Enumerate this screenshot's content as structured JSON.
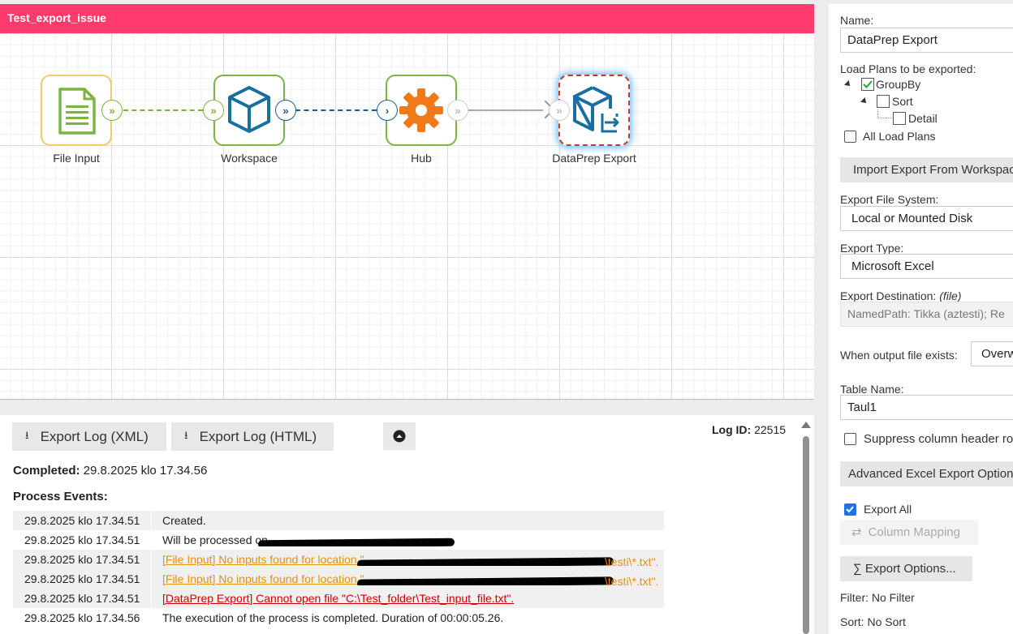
{
  "canvas": {
    "title": "Test_export_issue",
    "nodes": [
      {
        "label": "File Input",
        "icon": "document-icon",
        "border": "#f3c96b"
      },
      {
        "label": "Workspace",
        "icon": "cube-icon",
        "border": "#7cb342"
      },
      {
        "label": "Hub",
        "icon": "gear-icon",
        "border": "#7cb342"
      },
      {
        "label": "DataPrep Export",
        "icon": "cube-export-icon",
        "border": "#c0392b"
      }
    ],
    "colors": {
      "title_bar": "#ff3a6c",
      "green_port": "#7cb342",
      "blue_port": "#1a5e8c",
      "gear": "#f07a1a",
      "cube": "#1a6ea0"
    }
  },
  "log": {
    "export_xml_label": "Export Log (XML)",
    "export_html_label": "Export Log (HTML)",
    "log_id_label": "Log ID:",
    "log_id_value": "22515",
    "completed_label": "Completed:",
    "completed_value": "29.8.2025 klo 17.34.56",
    "events_heading": "Process Events:",
    "events": [
      {
        "time": "29.8.2025 klo 17.34.51",
        "text": "Created.",
        "level": "info"
      },
      {
        "time": "29.8.2025 klo 17.34.51",
        "text": "Will be processed on",
        "level": "info"
      },
      {
        "time": "29.8.2025 klo 17.34.51",
        "text": "[File Input] No inputs found for location \"",
        "suffix": "\\testi\\*.txt\".",
        "level": "warn"
      },
      {
        "time": "29.8.2025 klo 17.34.51",
        "text": "[File Input] No inputs found for location \"",
        "suffix": "\\testi\\*.txt\".",
        "level": "warn"
      },
      {
        "time": "29.8.2025 klo 17.34.51",
        "text": "[DataPrep Export] Cannot open file \"C:\\Test_folder\\Test_input_file.txt\".",
        "level": "err"
      },
      {
        "time": "29.8.2025 klo 17.34.56",
        "text": "The execution of the process is completed. Duration of 00:00:05.26.",
        "level": "info"
      }
    ]
  },
  "panel": {
    "name_label": "Name:",
    "name_value": "DataPrep Export",
    "load_plans_label": "Load Plans to be exported:",
    "tree": [
      {
        "label": "GroupBy",
        "checked": true
      },
      {
        "label": "Sort",
        "checked": false
      },
      {
        "label": "Detail",
        "checked": false
      }
    ],
    "all_load_plans_label": "All Load Plans",
    "import_button": "Import Export From Workspace",
    "file_system_label": "Export File System:",
    "file_system_value": "Local or Mounted Disk",
    "export_type_label": "Export Type:",
    "export_type_value": "Microsoft Excel",
    "destination_label": "Export Destination:",
    "destination_hint": "(file)",
    "destination_value": "NamedPath: Tikka (aztesti); Re",
    "when_exists_label": "When output file exists:",
    "when_exists_value": "Overw",
    "table_name_label": "Table Name:",
    "table_name_value": "Taul1",
    "suppress_label": "Suppress column header ro",
    "advanced_button": "Advanced Excel Export Options",
    "export_all_label": "Export All",
    "column_mapping_label": "Column Mapping",
    "export_options_label": "Export Options...",
    "filter_label": "Filter:",
    "filter_value": "No Filter",
    "sort_label": "Sort:",
    "sort_value": "No Sort"
  }
}
